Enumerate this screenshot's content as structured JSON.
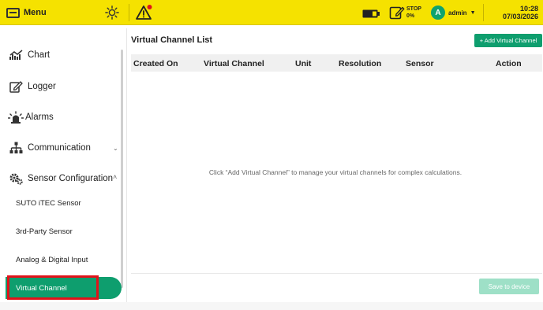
{
  "topbar": {
    "menu_label": "Menu",
    "icons": [
      "hamburger-icon",
      "brightness-icon",
      "alert-warning-icon",
      "battery-icon",
      "record-stop-icon"
    ],
    "stop_label": "STOP",
    "stop_value": "0%",
    "avatar_letter": "A",
    "username": "admin",
    "time": "10:28",
    "date": "07/03/2026",
    "colors": {
      "bar": "#f5e200",
      "alert_dot": "#e0131a",
      "avatar": "#0ea36e"
    }
  },
  "sidebar": {
    "chart": "Chart",
    "logger": "Logger",
    "alarms": "Alarms",
    "communication": "Communication",
    "sensor_configuration": "Sensor Configuration",
    "sub_items": {
      "suto": "SUTO iTEC Sensor",
      "third_party": "3rd-Party Sensor",
      "analog_digital": "Analog & Digital Input",
      "virtual_channel": "Virtual Channel"
    },
    "active_item": "Virtual Channel",
    "colors": {
      "active": "#0e9e6e",
      "highlight_box": "#e0131a"
    }
  },
  "main": {
    "title": "Virtual Channel List",
    "add_button": "+ Add Virtual Channel",
    "columns": {
      "created_on": "Created On",
      "virtual_channel": "Virtual Channel",
      "unit": "Unit",
      "resolution": "Resolution",
      "sensor": "Sensor",
      "action": "Action"
    },
    "rows": [],
    "empty_message": "Click “Add Virtual Channel” to manage your virtual channels for complex calculations.",
    "save_button": "Save to device",
    "colors": {
      "primary": "#0e9e6e",
      "disabled": "#9ee0c7"
    }
  }
}
